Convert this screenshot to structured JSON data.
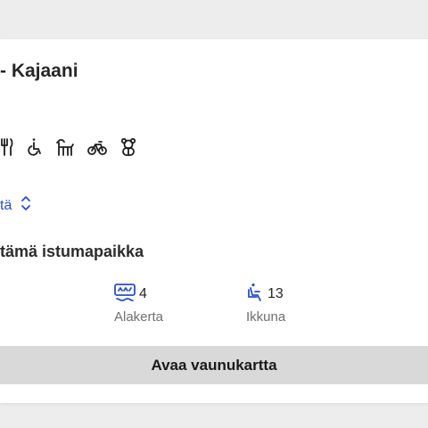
{
  "route": {
    "title": "- Kajaani"
  },
  "services": {
    "icons": [
      "restaurant-icon",
      "wheelchair-icon",
      "pet-icon",
      "bicycle-icon",
      "playroom-icon"
    ]
  },
  "toggle": {
    "label": "tä",
    "icon": "chevron-up-down-icon"
  },
  "seat_section": {
    "heading": "tämä istumapaikka",
    "location": {
      "icon": "lower-deck-icon",
      "number": "4",
      "label": "Alakerta"
    },
    "seat": {
      "icon": "window-seat-icon",
      "number": "13",
      "label": "Ikkuna"
    }
  },
  "map_button": {
    "label": "Avaa vaunukartta"
  },
  "colors": {
    "accent": "#2a4fc2",
    "button_bg": "#d9d9d9",
    "text": "#262626",
    "muted": "#707070"
  }
}
